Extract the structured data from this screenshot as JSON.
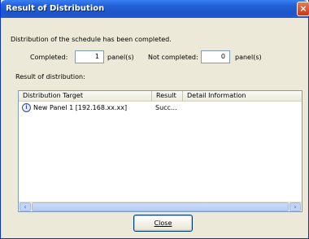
{
  "window": {
    "title": "Result of Distribution"
  },
  "summary": {
    "message": "Distribution of the schedule has been completed.",
    "completed_label": "Completed:",
    "completed_count": "1",
    "completed_unit": "panel(s)",
    "not_completed_label": "Not completed:",
    "not_completed_count": "0",
    "not_completed_unit": "panel(s)"
  },
  "result_section": {
    "label": "Result of distribution:"
  },
  "list": {
    "columns": [
      "Distribution Target",
      "Result",
      "Detail Information"
    ],
    "rows": [
      {
        "target": "New Panel 1 [192.168.xx.xx]",
        "result": "Succ...",
        "detail": "",
        "icon": "info-circle-icon"
      }
    ]
  },
  "scrollbar": {
    "left_arrow": "‹",
    "right_arrow": "›"
  },
  "buttons": {
    "close_label": "Close",
    "close_mnemonic": "C"
  },
  "colors": {
    "titlebar": "#2362d9",
    "window_bg": "#ece9d8",
    "close_red": "#c53a16"
  }
}
